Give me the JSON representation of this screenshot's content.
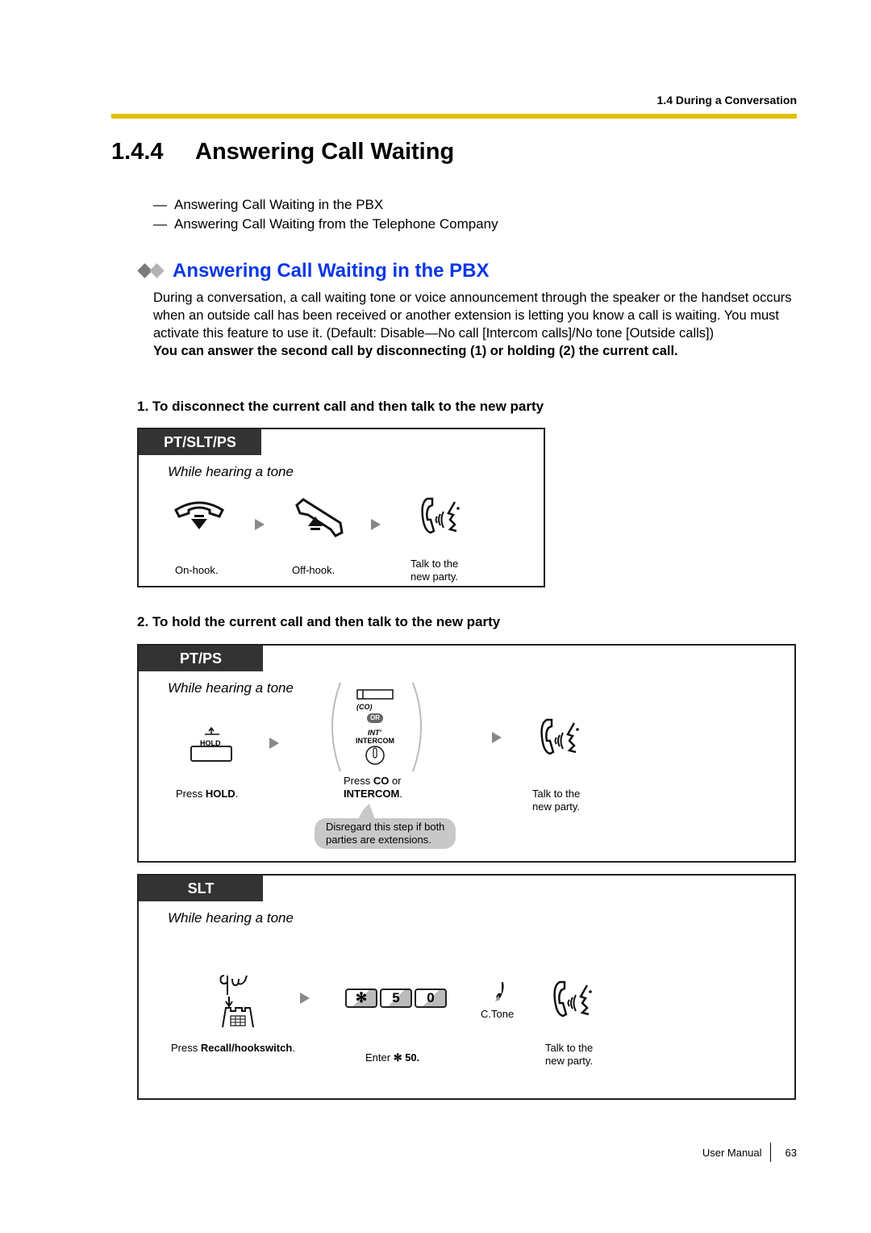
{
  "header": {
    "section": "1.4 During a Conversation",
    "accent_color": "#e3be00"
  },
  "title": {
    "number": "1.4.4",
    "text": "Answering Call Waiting"
  },
  "toc": [
    {
      "dash": "—",
      "label": "Answering Call Waiting in the PBX"
    },
    {
      "dash": "—",
      "label": "Answering Call Waiting from the Telephone Company"
    }
  ],
  "subsection": {
    "title": "Answering Call Waiting in the PBX",
    "color": "#0a37e6",
    "body": "During a conversation, a call waiting tone or voice announcement through the speaker or the handset occurs when an outside call has been received or another extension is letting you know a call is waiting. You must activate this feature to use it. (Default: Disable—No call [Intercom calls]/No tone [Outside calls])",
    "note": "You can answer the second call by disconnecting (1) or holding (2) the current call."
  },
  "step1": {
    "heading": "1. To disconnect the current call and then talk to the new party",
    "tab": "PT/SLT/PS",
    "condition": "While hearing a tone",
    "actions": [
      {
        "icon": "on-hook-icon",
        "label": "On-hook."
      },
      {
        "icon": "off-hook-icon",
        "label": "Off-hook."
      },
      {
        "icon": "talk-icon",
        "label1": "Talk to the",
        "label2": "new party."
      }
    ]
  },
  "step2": {
    "heading": "2. To hold the current call and then talk to the new party",
    "pt": {
      "tab": "PT/PS",
      "condition": "While hearing a tone",
      "hold_key": "HOLD",
      "hold_label_pre": "Press ",
      "hold_label_bold": "HOLD",
      "hold_label_post": ".",
      "co_key": "(CO)",
      "or": "OR",
      "int_key": "INT'",
      "intercom_key": "INTERCOM",
      "press_pre": "Press ",
      "press_co": "CO",
      "press_or": " or",
      "press_intercom": "INTERCOM",
      "press_post": ".",
      "talk1": "Talk to the",
      "talk2": "new party.",
      "bubble1": "Disregard this step if both",
      "bubble2": "parties are extensions."
    },
    "slt": {
      "tab": "SLT",
      "condition": "While hearing a tone",
      "recall_pre": "Press ",
      "recall_bold": "Recall/hookswitch",
      "recall_post": ".",
      "keys": [
        "✻",
        "5",
        "0"
      ],
      "enter_pre": "Enter ",
      "enter_bold": "✻ 50.",
      "tone": "C.Tone",
      "talk1": "Talk to the",
      "talk2": "new party."
    }
  },
  "footer": {
    "label": "User Manual",
    "page": "63"
  }
}
